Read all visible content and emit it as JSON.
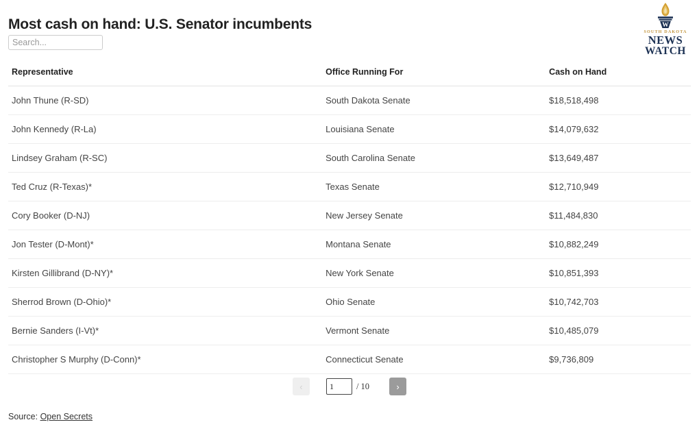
{
  "header": {
    "title": "Most cash on hand: U.S. Senator incumbents"
  },
  "search": {
    "placeholder": "Search...",
    "value": ""
  },
  "logo": {
    "icon": "torch-flame-icon",
    "line1": "SOUTH DAKOTA",
    "line2": "NEWS",
    "line3": "WATCH",
    "gold": "#c3963f",
    "navy": "#1d3254"
  },
  "table": {
    "columns": [
      "Representative",
      "Office Running For",
      "Cash on Hand"
    ],
    "rows": [
      {
        "representative": "John Thune (R-SD)",
        "office": "South Dakota Senate",
        "cash": "$18,518,498"
      },
      {
        "representative": "John Kennedy (R-La)",
        "office": "Louisiana Senate",
        "cash": "$14,079,632"
      },
      {
        "representative": "Lindsey Graham (R-SC)",
        "office": "South Carolina Senate",
        "cash": "$13,649,487"
      },
      {
        "representative": "Ted Cruz (R-Texas)*",
        "office": "Texas Senate",
        "cash": "$12,710,949"
      },
      {
        "representative": "Cory Booker (D-NJ)",
        "office": "New Jersey Senate",
        "cash": "$11,484,830"
      },
      {
        "representative": "Jon Tester (D-Mont)*",
        "office": "Montana Senate",
        "cash": "$10,882,249"
      },
      {
        "representative": "Kirsten Gillibrand (D-NY)*",
        "office": "New York Senate",
        "cash": "$10,851,393"
      },
      {
        "representative": "Sherrod Brown (D-Ohio)*",
        "office": "Ohio Senate",
        "cash": "$10,742,703"
      },
      {
        "representative": "Bernie Sanders (I-Vt)*",
        "office": "Vermont Senate",
        "cash": "$10,485,079"
      },
      {
        "representative": "Christopher S Murphy (D-Conn)*",
        "office": "Connecticut Senate",
        "cash": "$9,736,809"
      }
    ]
  },
  "pagination": {
    "prev_label": "‹",
    "next_label": "›",
    "current_page": "1",
    "total_label": "/ 10"
  },
  "footer": {
    "source_prefix": "Source: ",
    "source_link": "Open Secrets"
  }
}
